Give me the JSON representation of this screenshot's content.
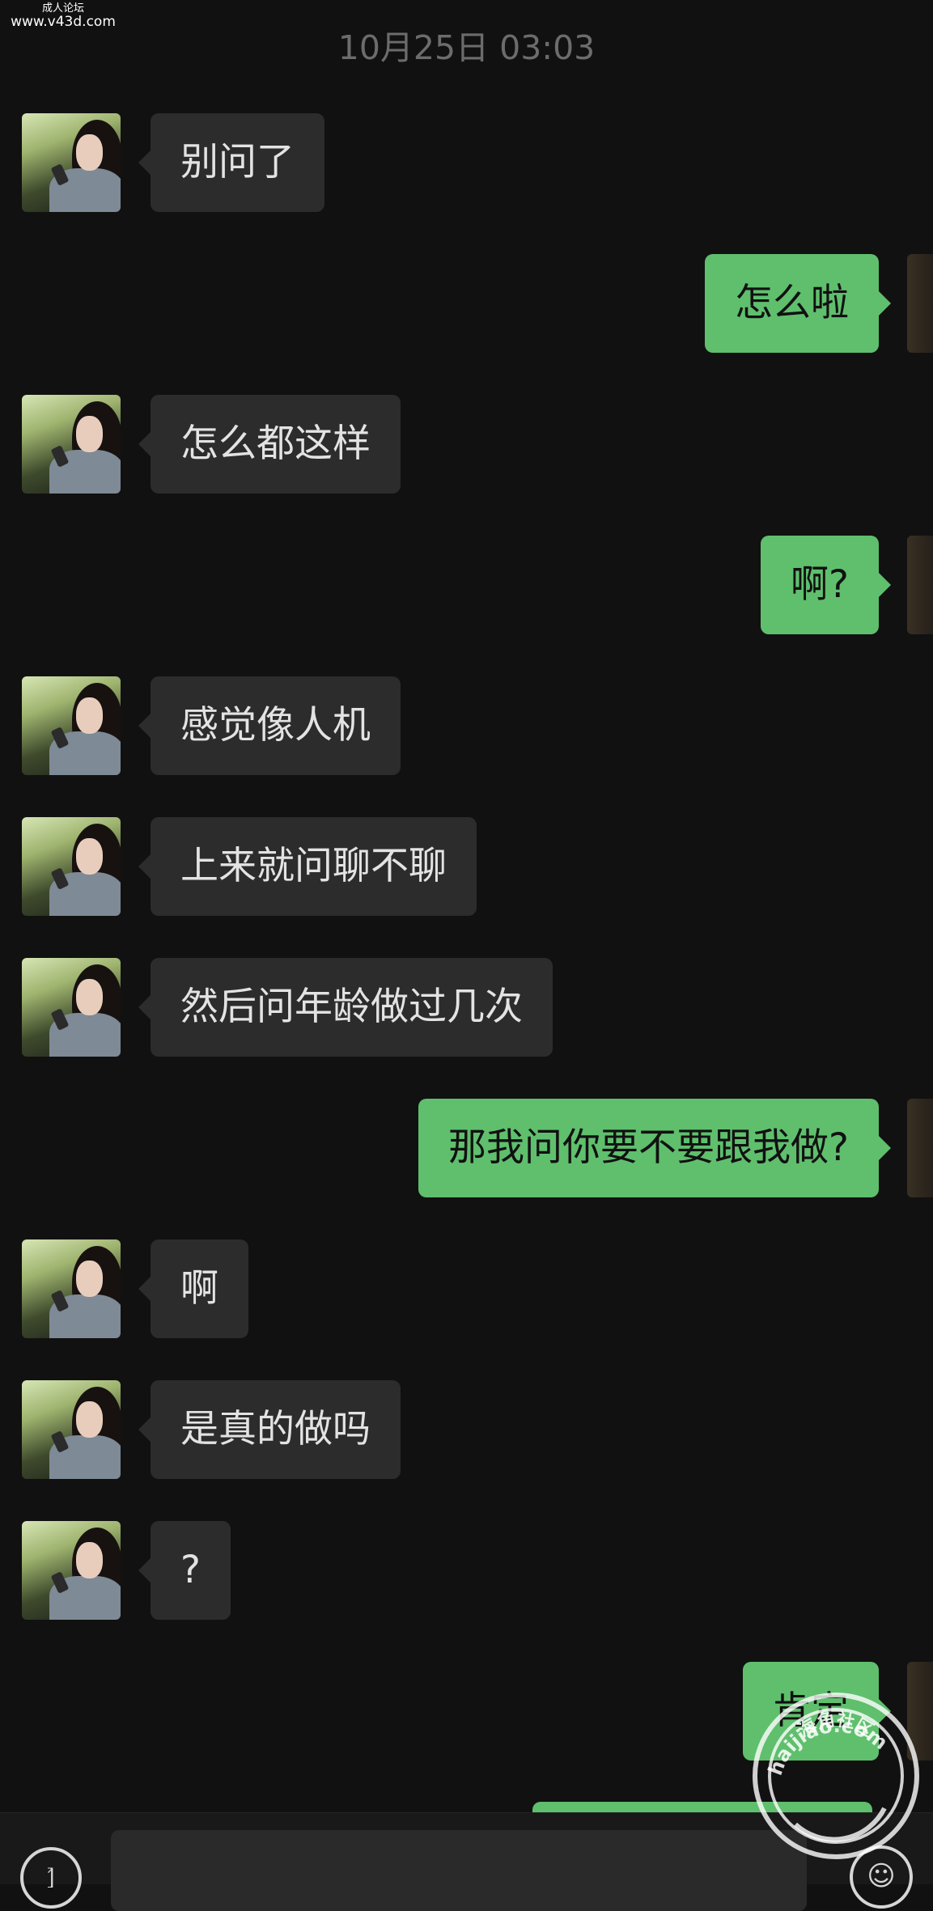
{
  "watermark_top": {
    "line1": "成人论坛",
    "line2": "www.v43d.com"
  },
  "timestamp": "10月25日 03:03",
  "messages": [
    {
      "side": "left",
      "text": "别问了"
    },
    {
      "side": "right",
      "text": "怎么啦"
    },
    {
      "side": "left",
      "text": "怎么都这样"
    },
    {
      "side": "right",
      "text": "啊?"
    },
    {
      "side": "left",
      "text": "感觉像人机"
    },
    {
      "side": "left",
      "text": "上来就问聊不聊"
    },
    {
      "side": "left",
      "text": "然后问年龄做过几次"
    },
    {
      "side": "right",
      "text": "那我问你要不要跟我做?"
    },
    {
      "side": "left",
      "text": "啊"
    },
    {
      "side": "left",
      "text": "是真的做吗"
    },
    {
      "side": "left",
      "text": "?"
    },
    {
      "side": "right",
      "text": "肯定"
    }
  ],
  "input_bar": {
    "voice_icon": "voice-icon",
    "emoji_icon": "emoji-icon",
    "input_value": ""
  },
  "watermark_seal": {
    "text": "海角社区",
    "url": "haijiao.com"
  },
  "colors": {
    "background": "#111111",
    "incoming_bubble": "#2c2c2c",
    "outgoing_bubble": "#5fbf6d",
    "timestamp": "#6c6c6c"
  }
}
